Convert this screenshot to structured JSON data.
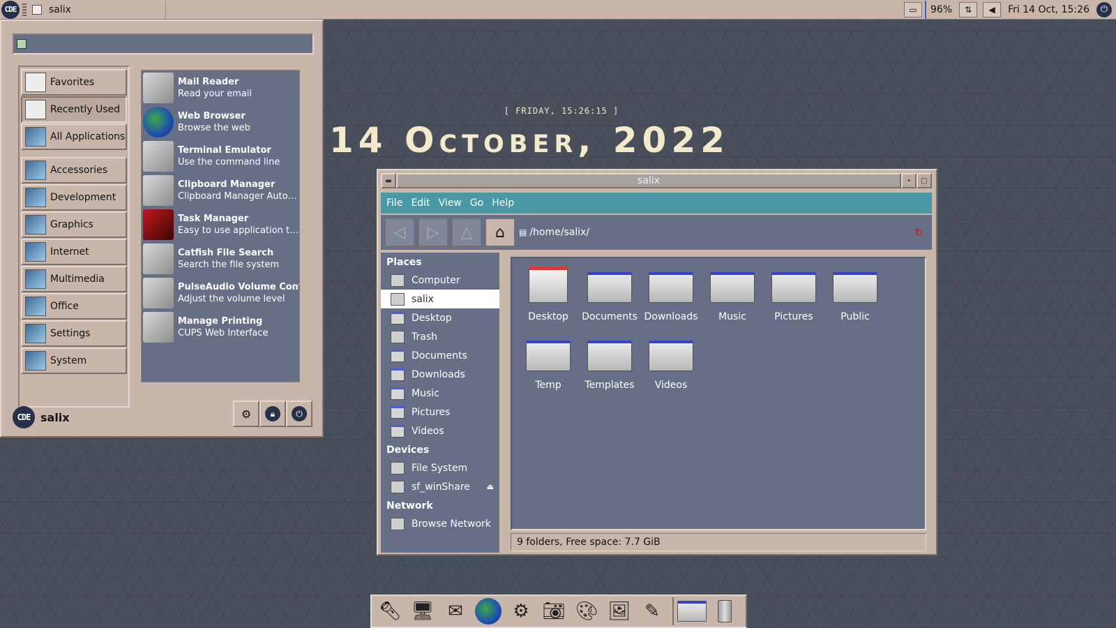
{
  "top_panel": {
    "logo": "CDE",
    "task_title": "salix",
    "battery": "96%",
    "clock": "Fri 14 Oct, 15:26",
    "icons": [
      "cde-logo-icon",
      "window-icon",
      "screenshot-icon",
      "network-icon",
      "volume-icon",
      "power-icon"
    ]
  },
  "desktop_clock": {
    "small": "[ FRIDAY, 15:26:15 ]",
    "big": "14 October, 2022"
  },
  "start_menu": {
    "search": {
      "value": "",
      "placeholder": ""
    },
    "categories": [
      {
        "label": "Favorites"
      },
      {
        "label": "Recently Used"
      },
      {
        "label": "All Applications"
      },
      {
        "label": "Accessories"
      },
      {
        "label": "Development"
      },
      {
        "label": "Graphics"
      },
      {
        "label": "Internet"
      },
      {
        "label": "Multimedia"
      },
      {
        "label": "Office"
      },
      {
        "label": "Settings"
      },
      {
        "label": "System"
      }
    ],
    "apps": [
      {
        "name": "Mail Reader",
        "desc": "Read your email"
      },
      {
        "name": "Web Browser",
        "desc": "Browse the web"
      },
      {
        "name": "Terminal Emulator",
        "desc": "Use the command line"
      },
      {
        "name": "Clipboard Manager",
        "desc": "Clipboard Manager Autostart File"
      },
      {
        "name": "Task Manager",
        "desc": "Easy to use application to monitor system resources"
      },
      {
        "name": "Catfish File Search",
        "desc": "Search the file system"
      },
      {
        "name": "PulseAudio Volume Control",
        "desc": "Adjust the volume level"
      },
      {
        "name": "Manage Printing",
        "desc": "CUPS Web Interface"
      }
    ],
    "user": "salix",
    "user_logo": "CDE"
  },
  "file_manager": {
    "title": "salix",
    "menu": [
      "File",
      "Edit",
      "View",
      "Go",
      "Help"
    ],
    "path": "/home/salix/",
    "sidebar": {
      "places_header": "Places",
      "places": [
        "Computer",
        "salix",
        "Desktop",
        "Trash",
        "Documents",
        "Downloads",
        "Music",
        "Pictures",
        "Videos"
      ],
      "devices_header": "Devices",
      "devices": [
        "File System",
        "sf_winShare"
      ],
      "network_header": "Network",
      "network": [
        "Browse Network"
      ]
    },
    "files": [
      "Desktop",
      "Documents",
      "Downloads",
      "Music",
      "Pictures",
      "Public",
      "Temp",
      "Templates",
      "Videos"
    ],
    "status": "9 folders, Free space: 7.7 GiB"
  },
  "dock": {
    "items": [
      "flashlight-icon",
      "terminal-icon",
      "mail-icon",
      "web-browser-icon",
      "settings-icon",
      "camera-icon",
      "paint-icon",
      "image-viewer-icon",
      "help-editor-icon",
      "file-manager-icon",
      "trash-icon"
    ]
  }
}
